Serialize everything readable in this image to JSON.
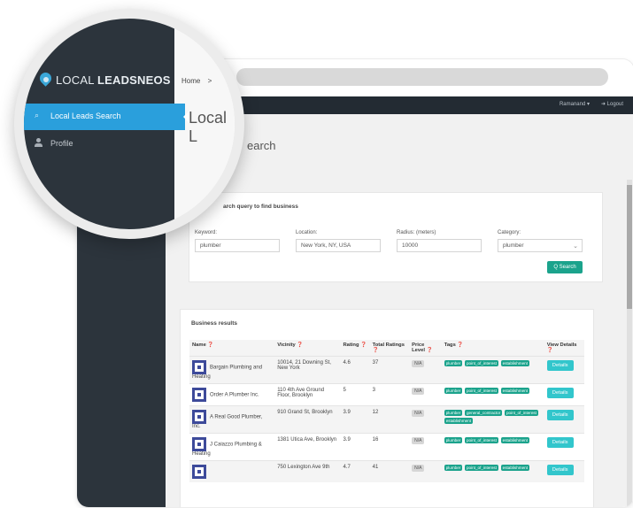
{
  "app": {
    "logo_light": "LOCAL ",
    "logo_bold": "LEADSNEOS",
    "breadcrumb": "Home",
    "breadcrumb_sep": ">",
    "page_title": "Local Leads Search",
    "page_title_partial": "Local L",
    "main_title_partial": "earch"
  },
  "sidebar": {
    "items": [
      {
        "label": "Local Leads Search",
        "icon": "search-icon",
        "active": true
      },
      {
        "label": "Profile",
        "icon": "user-icon",
        "active": false
      }
    ]
  },
  "topbar": {
    "user": "Ramanand ▾",
    "logout": "➜ Logout"
  },
  "search": {
    "title": "arch query to find business",
    "keyword_label": "Keyword:",
    "keyword_value": "plumber",
    "location_label": "Location:",
    "location_value": "New York, NY, USA",
    "radius_label": "Radius: (meters)",
    "radius_value": "10000",
    "category_label": "Category:",
    "category_value": "plumber",
    "search_button": "Q Search"
  },
  "results": {
    "title": "Business results",
    "columns": [
      "Name ❓",
      "Vicinity ❓",
      "Rating ❓",
      "Total Ratings ❓",
      "Price Level ❓",
      "Tags ❓",
      "View Details ❓"
    ],
    "rows": [
      {
        "name": "Bargain Plumbing and Heating",
        "vicinity": "10014, 21 Downing St, New York",
        "rating": "4.6",
        "total": "37",
        "price": "N/A",
        "tags": [
          "plumber",
          "point_of_interest",
          "establishment"
        ],
        "details": "Details"
      },
      {
        "name": "Order A Plumber Inc.",
        "vicinity": "110 4th Ave Ground Floor, Brooklyn",
        "rating": "5",
        "total": "3",
        "price": "N/A",
        "tags": [
          "plumber",
          "point_of_interest",
          "establishment"
        ],
        "details": "Details"
      },
      {
        "name": "A Real Good Plumber, Inc.",
        "vicinity": "910 Grand St, Brooklyn",
        "rating": "3.9",
        "total": "12",
        "price": "N/A",
        "tags": [
          "plumber",
          "general_contractor",
          "point_of_interest",
          "establishment"
        ],
        "details": "Details"
      },
      {
        "name": "J Caiazzo Plumbing & Heating",
        "vicinity": "1381 Utica Ave, Brooklyn",
        "rating": "3.9",
        "total": "16",
        "price": "N/A",
        "tags": [
          "plumber",
          "point_of_interest",
          "establishment"
        ],
        "details": "Details"
      },
      {
        "name": "",
        "vicinity": "750 Lexington Ave 9th",
        "rating": "4.7",
        "total": "41",
        "price": "N/A",
        "tags": [
          "plumber",
          "point_of_interest",
          "establishment"
        ],
        "details": "Details"
      }
    ]
  },
  "colors": {
    "sidebar_dark": "#2c343c",
    "active_blue": "#2a9fdc",
    "accent_green": "#1ba38c",
    "details_cyan": "#32c6cc",
    "business_icon": "#3d4a9a"
  }
}
